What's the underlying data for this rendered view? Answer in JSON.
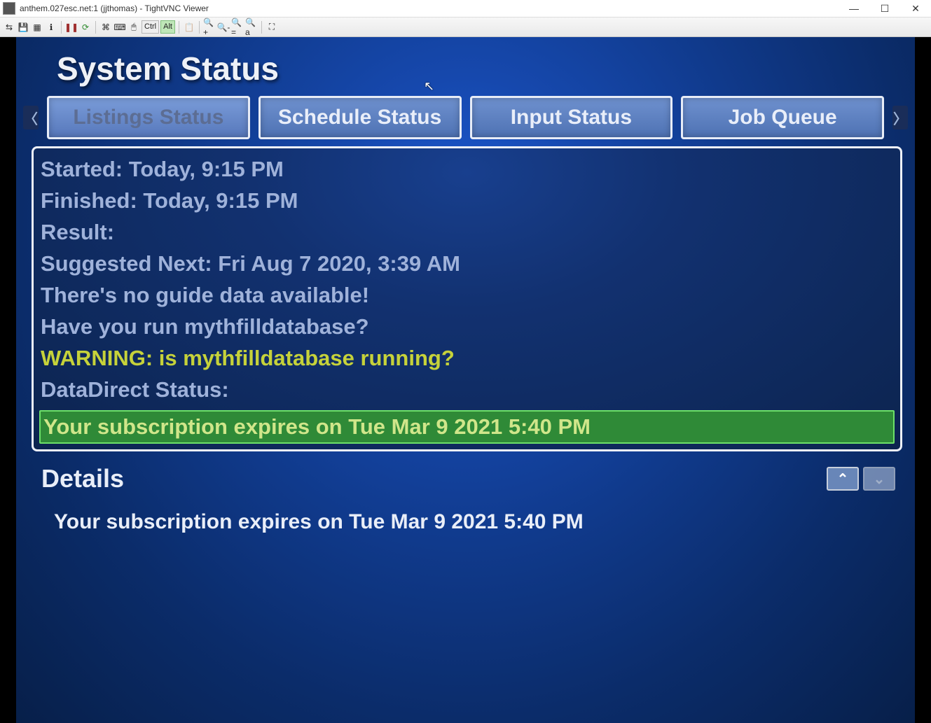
{
  "window": {
    "title": "anthem.027esc.net:1 (jjthomas) - TightVNC Viewer"
  },
  "toolbar": {
    "keys": {
      "ctrl": "Ctrl",
      "alt": "Alt"
    }
  },
  "page": {
    "title": "System Status",
    "tabs": [
      "Listings Status",
      "Schedule Status",
      "Input Status",
      "Job Queue"
    ],
    "details_heading": "Details",
    "details_text": "Your subscription expires on Tue Mar 9 2021 5:40 PM"
  },
  "status": {
    "started": "Started:   Today, 9:15 PM",
    "finished": "Finished: Today, 9:15 PM",
    "result": "Result:",
    "suggested": "Suggested Next: Fri Aug 7 2020, 3:39 AM",
    "noguide": "There's no guide data available!",
    "haveyou": "Have you run mythfilldatabase?",
    "warning": "WARNING: is mythfilldatabase running?",
    "datadirect": "DataDirect Status:",
    "subscription": "Your subscription expires on Tue Mar 9 2021 5:40 PM"
  }
}
